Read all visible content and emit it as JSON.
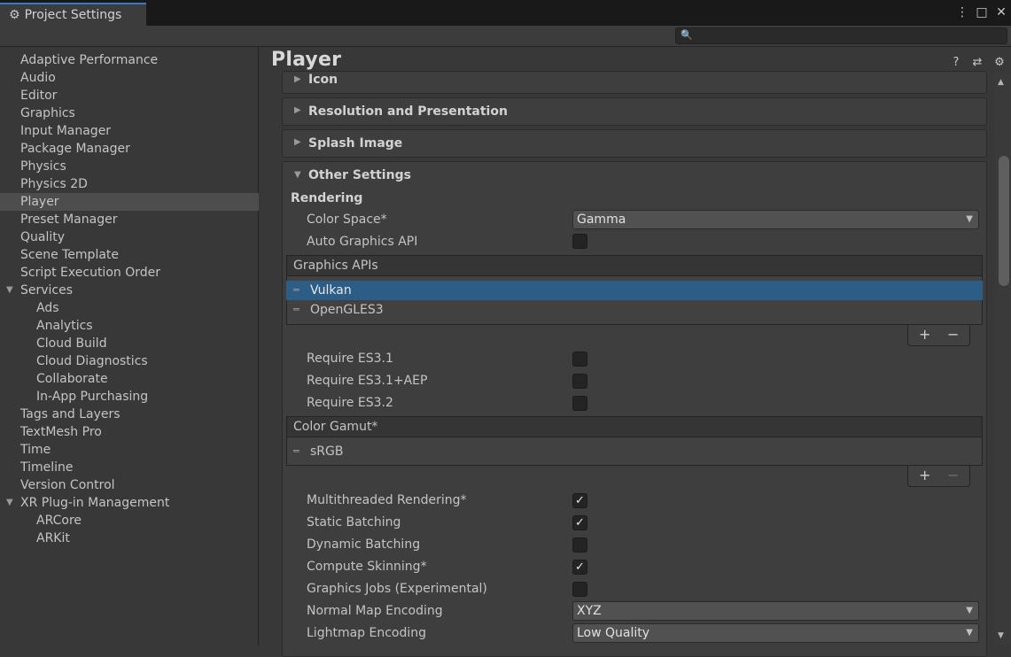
{
  "window": {
    "tab_title": "Project Settings",
    "controls": [
      "⋮",
      "□",
      "✕"
    ]
  },
  "search": {
    "placeholder": ""
  },
  "sidebar": {
    "items": [
      {
        "label": "Adaptive Performance",
        "indent": 0
      },
      {
        "label": "Audio",
        "indent": 0
      },
      {
        "label": "Editor",
        "indent": 0
      },
      {
        "label": "Graphics",
        "indent": 0
      },
      {
        "label": "Input Manager",
        "indent": 0
      },
      {
        "label": "Package Manager",
        "indent": 0
      },
      {
        "label": "Physics",
        "indent": 0
      },
      {
        "label": "Physics 2D",
        "indent": 0
      },
      {
        "label": "Player",
        "indent": 0,
        "selected": true
      },
      {
        "label": "Preset Manager",
        "indent": 0
      },
      {
        "label": "Quality",
        "indent": 0
      },
      {
        "label": "Scene Template",
        "indent": 0
      },
      {
        "label": "Script Execution Order",
        "indent": 0
      },
      {
        "label": "Services",
        "indent": 0,
        "expanded": true
      },
      {
        "label": "Ads",
        "indent": 1
      },
      {
        "label": "Analytics",
        "indent": 1
      },
      {
        "label": "Cloud Build",
        "indent": 1
      },
      {
        "label": "Cloud Diagnostics",
        "indent": 1
      },
      {
        "label": "Collaborate",
        "indent": 1
      },
      {
        "label": "In-App Purchasing",
        "indent": 1
      },
      {
        "label": "Tags and Layers",
        "indent": 0
      },
      {
        "label": "TextMesh Pro",
        "indent": 0
      },
      {
        "label": "Time",
        "indent": 0
      },
      {
        "label": "Timeline",
        "indent": 0
      },
      {
        "label": "Version Control",
        "indent": 0
      },
      {
        "label": "XR Plug-in Management",
        "indent": 0,
        "expanded": true
      },
      {
        "label": "ARCore",
        "indent": 1
      },
      {
        "label": "ARKit",
        "indent": 1
      }
    ]
  },
  "main": {
    "title": "Player",
    "header_icons": [
      "help-icon",
      "presets-icon",
      "settings-icon"
    ],
    "sections": {
      "icon": "Icon",
      "resolution": "Resolution and Presentation",
      "splash": "Splash Image",
      "other": "Other Settings"
    },
    "rendering_header": "Rendering",
    "color_space": {
      "label": "Color Space*",
      "value": "Gamma"
    },
    "auto_graphics_api": {
      "label": "Auto Graphics API",
      "checked": false
    },
    "graphics_apis": {
      "header": "Graphics APIs",
      "items": [
        {
          "label": "Vulkan",
          "selected": true
        },
        {
          "label": "OpenGLES3",
          "selected": false
        }
      ],
      "add": "+",
      "remove": "−"
    },
    "require_es31": {
      "label": "Require ES3.1",
      "checked": false
    },
    "require_es31_aep": {
      "label": "Require ES3.1+AEP",
      "checked": false
    },
    "require_es32": {
      "label": "Require ES3.2",
      "checked": false
    },
    "color_gamut": {
      "header": "Color Gamut*",
      "items": [
        {
          "label": "sRGB"
        }
      ],
      "add": "+",
      "remove": "−"
    },
    "multithreaded": {
      "label": "Multithreaded Rendering*",
      "checked": true,
      "mark": "✓"
    },
    "static_batching": {
      "label": "Static Batching",
      "checked": true,
      "mark": "✓"
    },
    "dynamic_batching": {
      "label": "Dynamic Batching",
      "checked": false
    },
    "compute_skinning": {
      "label": "Compute Skinning*",
      "checked": true,
      "mark": "✓"
    },
    "graphics_jobs": {
      "label": "Graphics Jobs (Experimental)",
      "checked": false
    },
    "normal_map": {
      "label": "Normal Map Encoding",
      "value": "XYZ"
    },
    "lightmap": {
      "label": "Lightmap Encoding",
      "value": "Low Quality"
    }
  },
  "colors": {
    "accent": "#3a79bb",
    "selection": "#2c5d87",
    "background": "#383838"
  }
}
